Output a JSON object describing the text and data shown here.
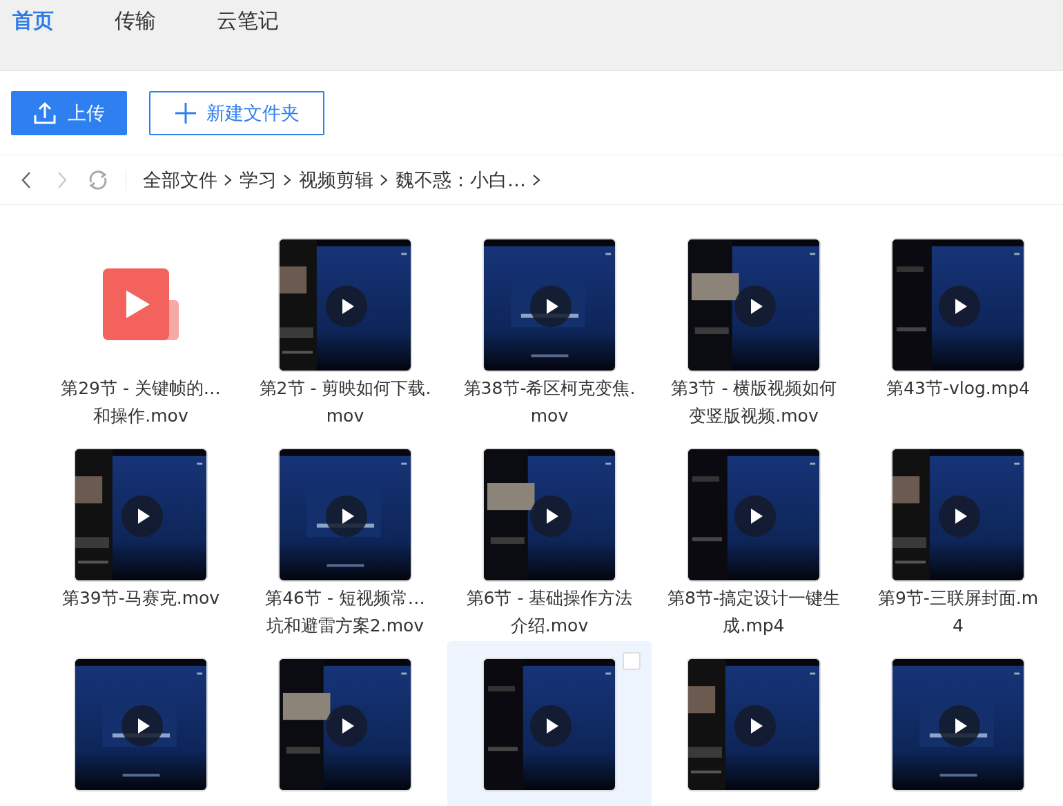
{
  "tabs": [
    {
      "label": "首页",
      "selected": true
    },
    {
      "label": "传输",
      "selected": false
    },
    {
      "label": "云笔记",
      "selected": false
    }
  ],
  "toolbar": {
    "upload": "上传",
    "new_folder": "新建文件夹"
  },
  "breadcrumb": {
    "back_disabled": false,
    "forward_disabled": true,
    "items": [
      "全部文件",
      "学习",
      "视频剪辑",
      "魏不惑：小白…"
    ]
  },
  "files": [
    {
      "kind": "file-icon",
      "name_lines": [
        "第29节 - 关键帧的…",
        "和操作.mov"
      ],
      "hovered": false
    },
    {
      "kind": "video",
      "name_lines": [
        "第2节 - 剪映如何下载.",
        "mov"
      ],
      "hovered": false
    },
    {
      "kind": "video",
      "name_lines": [
        "第38节-希区柯克变焦.",
        "mov"
      ],
      "hovered": false
    },
    {
      "kind": "video",
      "name_lines": [
        "第3节 - 横版视频如何",
        "变竖版视频.mov"
      ],
      "hovered": false
    },
    {
      "kind": "video",
      "name_lines": [
        "第43节-vlog.mp4"
      ],
      "hovered": false
    },
    {
      "kind": "video",
      "name_lines": [
        "第39节-马赛克.mov"
      ],
      "hovered": false
    },
    {
      "kind": "video",
      "name_lines": [
        "第46节 - 短视频常…",
        "坑和避雷方案2.mov"
      ],
      "hovered": false
    },
    {
      "kind": "video",
      "name_lines": [
        "第6节 - 基础操作方法",
        "介绍.mov"
      ],
      "hovered": false
    },
    {
      "kind": "video",
      "name_lines": [
        "第8节-搞定设计一键生",
        "成.mp4"
      ],
      "hovered": false
    },
    {
      "kind": "video",
      "name_lines": [
        "第9节-三联屏封面.m",
        "4"
      ],
      "hovered": false
    },
    {
      "kind": "video",
      "hovered": false
    },
    {
      "kind": "video",
      "hovered": false
    },
    {
      "kind": "video",
      "hovered": true
    },
    {
      "kind": "video",
      "hovered": false
    },
    {
      "kind": "video",
      "hovered": false
    }
  ]
}
